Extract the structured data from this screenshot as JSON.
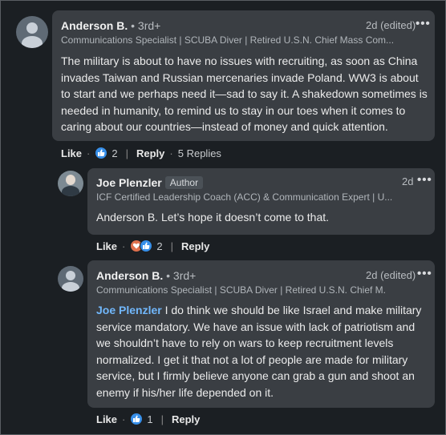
{
  "comments": [
    {
      "author": "Anderson B.",
      "degree": "• 3rd+",
      "headline": "Communications Specialist | SCUBA Diver | Retired U.S.N. Chief Mass Com...",
      "time": "2d (edited)",
      "text": "The military is about to have no issues with recruiting, as soon as China invades Taiwan and Russian mercenaries invade Poland. WW3 is about to start and we perhaps need it—sad to say it. A shakedown sometimes is needed in humanity, to remind us to stay in our toes when it comes to caring about our countries—instead of money and quick attention.",
      "like_label": "Like",
      "reaction_count": "2",
      "reply_label": "Reply",
      "replies_label": "5 Replies"
    },
    {
      "author": "Joe Plenzler",
      "badge": "Author",
      "headline": "ICF Certified Leadership Coach (ACC) & Communication Expert | U...",
      "time": "2d",
      "text": "Anderson B. Let’s hope it doesn’t come to that.",
      "like_label": "Like",
      "reaction_count": "2",
      "reply_label": "Reply"
    },
    {
      "author": "Anderson B.",
      "degree": "• 3rd+",
      "headline": "Communications Specialist | SCUBA Diver | Retired U.S.N. Chief M...",
      "time": "2d (edited)",
      "mention": "Joe Plenzler",
      "text": " I do think we should be like Israel and make military service mandatory. We have an issue with lack of patriotism and we shouldn’t have to rely on wars to keep recruitment levels normalized. I get it that not a lot of people are made for military service, but I firmly believe anyone can grab a gun and shoot an enemy if his/her life depended on it.",
      "like_label": "Like",
      "reaction_count": "1",
      "reply_label": "Reply"
    }
  ],
  "more_icon": "•••",
  "colors": {
    "background": "#1b1f23",
    "bubble": "#3a3e43",
    "mention": "#71b7fb",
    "like": "#378fe9",
    "love": "#df704d"
  }
}
